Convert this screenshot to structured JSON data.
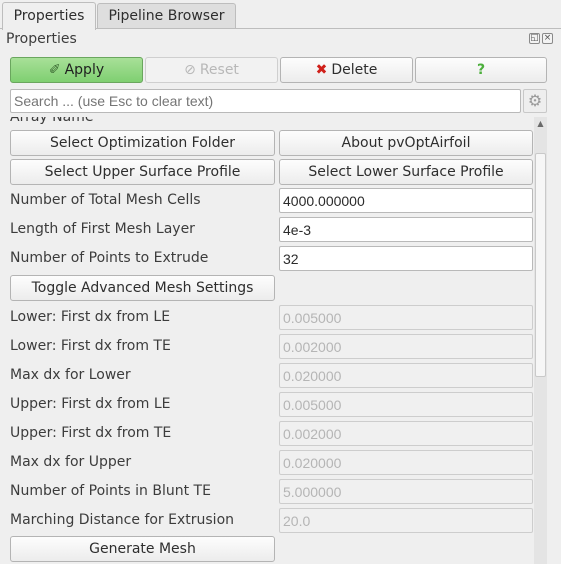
{
  "tabs": [
    {
      "label": "Properties"
    },
    {
      "label": "Pipeline Browser"
    }
  ],
  "panel": {
    "title": "Properties"
  },
  "toolbar": {
    "apply_label": "Apply",
    "reset_label": "Reset",
    "delete_label": "Delete",
    "help_label": "?"
  },
  "search": {
    "placeholder": "Search ... (use Esc to clear text)"
  },
  "partial_header": "Array Name",
  "buttons": {
    "select_optimization_folder": "Select Optimization Folder",
    "about": "About pvOptAirfoil",
    "select_upper": "Select Upper Surface Profile",
    "select_lower": "Select Lower Surface Profile",
    "toggle_advanced": "Toggle Advanced Mesh Settings",
    "generate_mesh": "Generate Mesh"
  },
  "fields": [
    {
      "label": "Number of Total Mesh Cells",
      "value": "4000.000000",
      "enabled": true
    },
    {
      "label": "Length of First Mesh Layer",
      "value": "4e-3",
      "enabled": true
    },
    {
      "label": "Number of Points to Extrude",
      "value": "32",
      "enabled": true
    }
  ],
  "advanced_fields": [
    {
      "label": "Lower: First dx from LE",
      "value": "0.005000"
    },
    {
      "label": "Lower: First dx from TE",
      "value": "0.002000"
    },
    {
      "label": "Max dx for Lower",
      "value": "0.020000"
    },
    {
      "label": "Upper: First dx from LE",
      "value": "0.005000"
    },
    {
      "label": "Upper: First dx from TE",
      "value": "0.002000"
    },
    {
      "label": "Max dx for Upper",
      "value": "0.020000"
    },
    {
      "label": "Number of Points in Blunt TE",
      "value": "5.000000"
    },
    {
      "label": "Marching Distance for Extrusion",
      "value": "20.0"
    }
  ],
  "colors": {
    "apply_green": "#7fcf71",
    "delete_red": "#d0201a",
    "help_green": "#4caf3c"
  }
}
